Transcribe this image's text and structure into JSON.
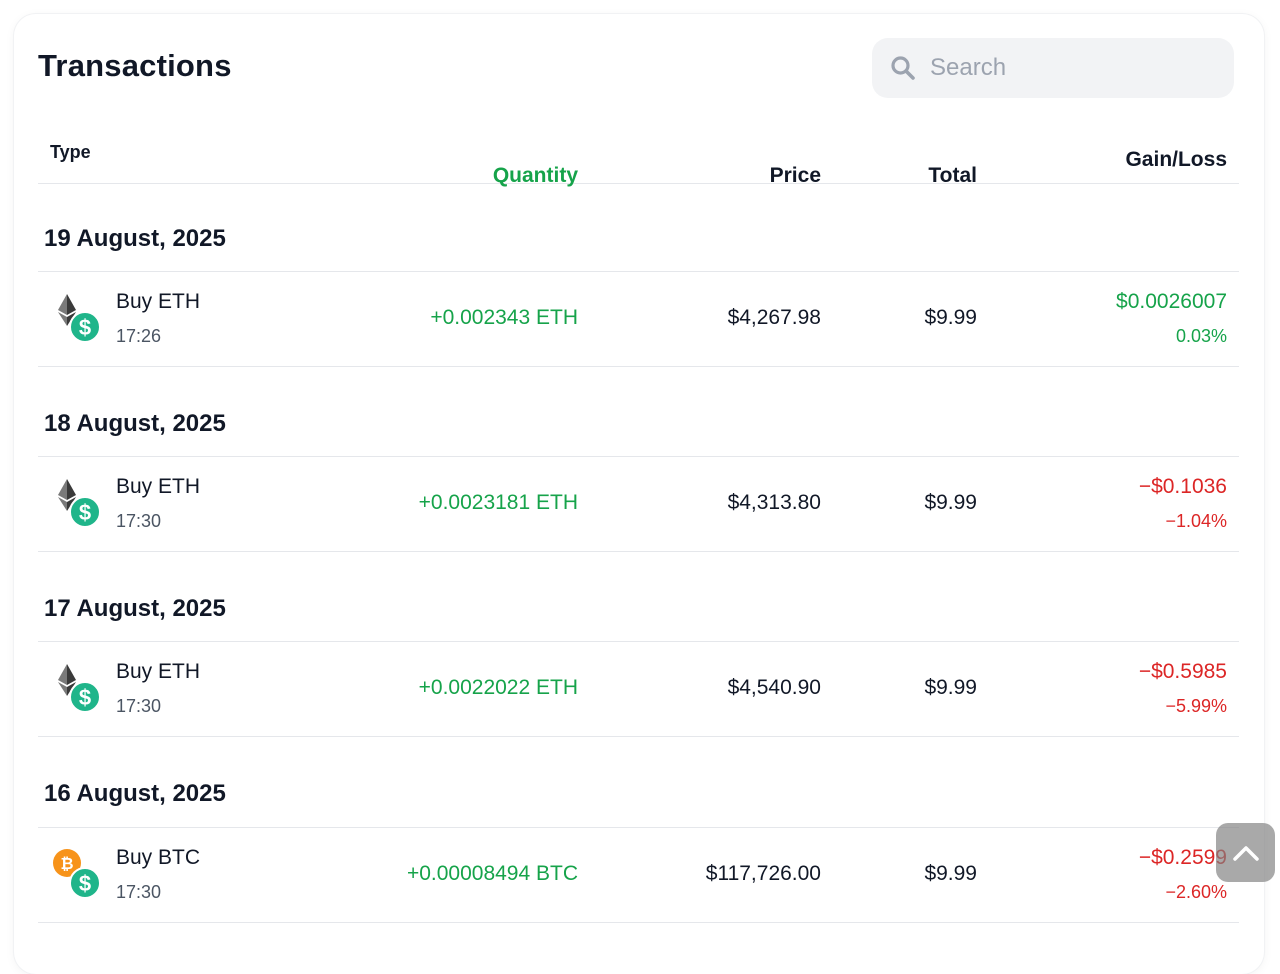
{
  "header": {
    "title": "Transactions",
    "search_placeholder": "Search",
    "search_value": ""
  },
  "columns": {
    "type": "Type",
    "quantity": "Quantity",
    "price": "Price",
    "total": "Total",
    "gain_loss": "Gain/Loss"
  },
  "groups": [
    {
      "date": "19 August, 2025",
      "rows": [
        {
          "coin": "eth",
          "icon": "ethereum-icon",
          "type": "Buy ETH",
          "time": "17:26",
          "quantity": "+0.002343 ETH",
          "price": "$4,267.98",
          "total": "$9.99",
          "gain": "$0.0026007",
          "gain_pct": "0.03%",
          "direction": "gain"
        }
      ]
    },
    {
      "date": "18 August, 2025",
      "rows": [
        {
          "coin": "eth",
          "icon": "ethereum-icon",
          "type": "Buy ETH",
          "time": "17:30",
          "quantity": "+0.0023181 ETH",
          "price": "$4,313.80",
          "total": "$9.99",
          "gain": "−$0.1036",
          "gain_pct": "−1.04%",
          "direction": "loss"
        }
      ]
    },
    {
      "date": "17 August, 2025",
      "rows": [
        {
          "coin": "eth",
          "icon": "ethereum-icon",
          "type": "Buy ETH",
          "time": "17:30",
          "quantity": "+0.0022022 ETH",
          "price": "$4,540.90",
          "total": "$9.99",
          "gain": "−$0.5985",
          "gain_pct": "−5.99%",
          "direction": "loss"
        }
      ]
    },
    {
      "date": "16 August, 2025",
      "rows": [
        {
          "coin": "btc",
          "icon": "bitcoin-icon",
          "type": "Buy BTC",
          "time": "17:30",
          "quantity": "+0.00008494 BTC",
          "price": "$117,726.00",
          "total": "$9.99",
          "gain": "−$0.2599",
          "gain_pct": "−2.60%",
          "direction": "loss"
        }
      ]
    }
  ],
  "colors": {
    "gain": "#16a34a",
    "loss": "#dc2626",
    "usd_badge": "#1fb58a",
    "btc_badge": "#f7931a"
  },
  "scroll_top_icon": "chevron-up-icon"
}
